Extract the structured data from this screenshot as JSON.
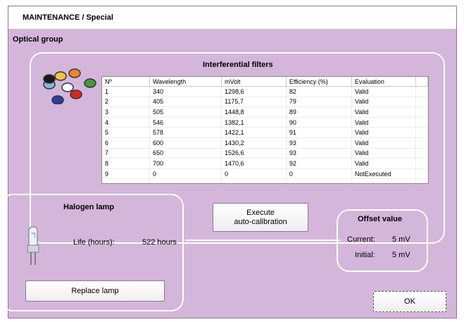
{
  "window": {
    "title": "MAINTENANCE / Special"
  },
  "optical_group": {
    "label": "Optical group"
  },
  "filters": {
    "title": "Interferential filters",
    "columns": [
      "Nº",
      "Wavelength",
      "mVolt",
      "Efficiency (%)",
      "Evaluation"
    ],
    "rows": [
      [
        "1",
        "340",
        "1298,6",
        "82",
        "Valid"
      ],
      [
        "2",
        "405",
        "1175,7",
        "79",
        "Valid"
      ],
      [
        "3",
        "505",
        "1448,8",
        "89",
        "Valid"
      ],
      [
        "4",
        "546",
        "1382,1",
        "90",
        "Valid"
      ],
      [
        "5",
        "578",
        "1422,1",
        "91",
        "Valid"
      ],
      [
        "6",
        "600",
        "1430,2",
        "93",
        "Valid"
      ],
      [
        "7",
        "650",
        "1526,6",
        "93",
        "Valid"
      ],
      [
        "8",
        "700",
        "1470,6",
        "92",
        "Valid"
      ],
      [
        "9",
        "0",
        "0",
        "0",
        "NotExecuted"
      ]
    ],
    "icon": "color-filters-icon",
    "filter_colors": [
      "#7fb8e0",
      "#f2c24a",
      "#e8862e",
      "#3f9a3a",
      "#ffffff",
      "#2b3f9e",
      "#d8261f",
      "#1a1a1a"
    ]
  },
  "halogen": {
    "title": "Halogen lamp",
    "life_label": "Life (hours):",
    "life_value": "522 hours",
    "icon": "halogen-lamp-icon",
    "replace_label": "Replace lamp"
  },
  "execute": {
    "label_line1": "Execute",
    "label_line2": "auto-calibration"
  },
  "offset": {
    "title": "Offset value",
    "current_label": "Current:",
    "current_value": "5 mV",
    "initial_label": "Initial:",
    "initial_value": "5 mV"
  },
  "ok_label": "OK",
  "colors": {
    "background": "#d4b6da",
    "border": "#ffffff"
  }
}
